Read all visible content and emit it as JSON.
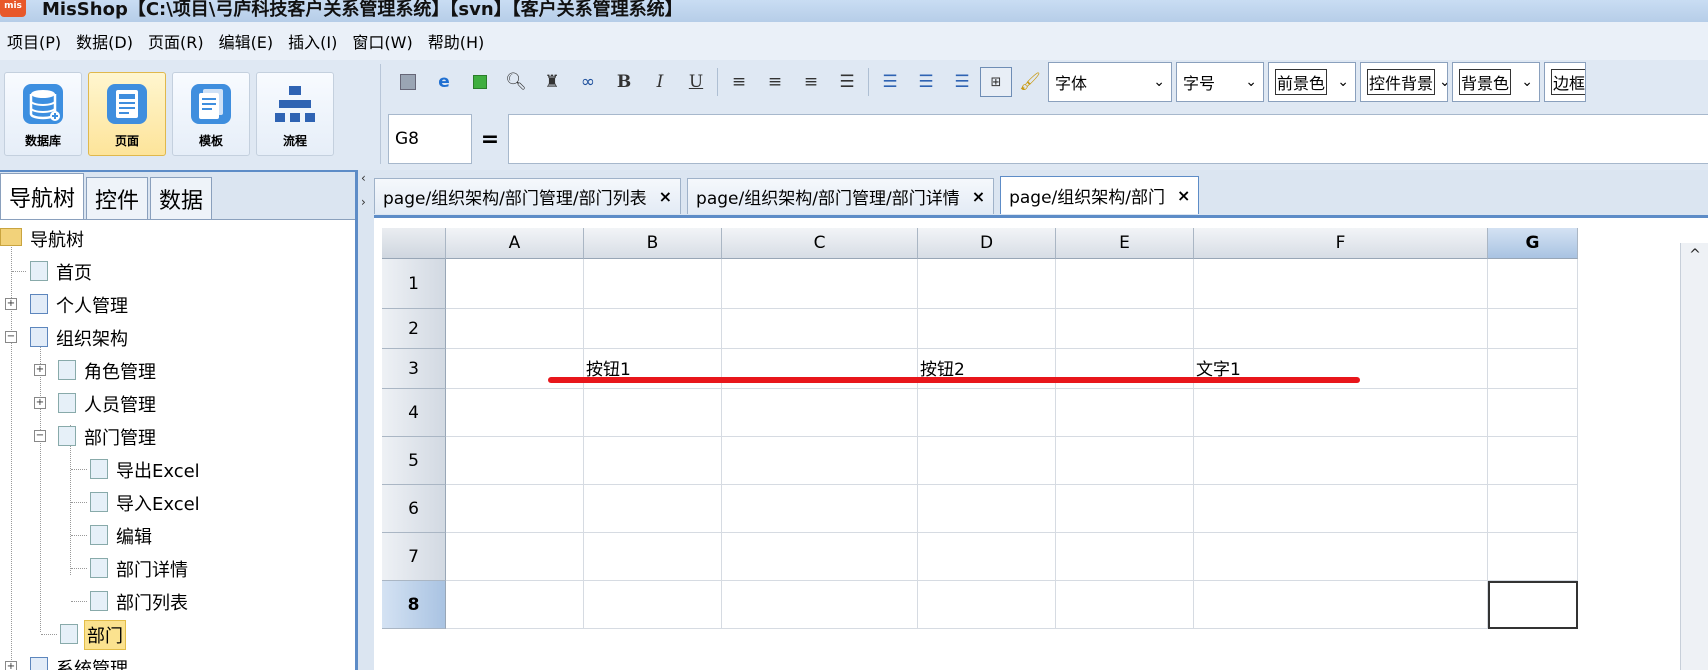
{
  "window": {
    "app_icon_text": "mis",
    "title": "MisShop【C:\\项目\\弓庐科技客户关系管理系统】【svn】【客户关系管理系统】"
  },
  "menu": [
    {
      "label": "项目(P)"
    },
    {
      "label": "数据(D)"
    },
    {
      "label": "页面(R)"
    },
    {
      "label": "编辑(E)"
    },
    {
      "label": "插入(I)"
    },
    {
      "label": "窗口(W)"
    },
    {
      "label": "帮助(H)"
    }
  ],
  "big_buttons": [
    {
      "label": "数据库",
      "icon": "database-icon",
      "color": "#3d8fe0"
    },
    {
      "label": "页面",
      "icon": "page-icon",
      "color": "#3f8ede"
    },
    {
      "label": "模板",
      "icon": "template-icon",
      "color": "#3f8ede"
    },
    {
      "label": "流程",
      "icon": "flowchart-icon",
      "color": "#2f63b3"
    }
  ],
  "toolbar": {
    "bold": "B",
    "italic": "I",
    "underline": "U",
    "font_select": "字体",
    "size_select": "字号",
    "fg_select": "前景色",
    "control_bg_select": "控件背景",
    "bg_select": "背景色",
    "border_select": "边框"
  },
  "formula": {
    "cell_ref": "G8",
    "equals": "=",
    "value": ""
  },
  "left_tabs": [
    {
      "label": "导航树"
    },
    {
      "label": "控件"
    },
    {
      "label": "数据"
    }
  ],
  "tree": [
    {
      "label": "导航树"
    },
    {
      "label": "首页"
    },
    {
      "label": "个人管理"
    },
    {
      "label": "组织架构"
    },
    {
      "label": "角色管理"
    },
    {
      "label": "人员管理"
    },
    {
      "label": "部门管理"
    },
    {
      "label": "导出Excel"
    },
    {
      "label": "导入Excel"
    },
    {
      "label": "编辑"
    },
    {
      "label": "部门详情"
    },
    {
      "label": "部门列表"
    },
    {
      "label": "部门"
    },
    {
      "label": "系统管理"
    }
  ],
  "doc_tabs": [
    {
      "label": "page/组织架构/部门管理/部门列表"
    },
    {
      "label": "page/组织架构/部门管理/部门详情"
    },
    {
      "label": "page/组织架构/部门"
    }
  ],
  "sheet": {
    "columns": [
      "A",
      "B",
      "C",
      "D",
      "E",
      "F",
      "G"
    ],
    "rows": [
      "1",
      "2",
      "3",
      "4",
      "5",
      "6",
      "7",
      "8"
    ],
    "selected_cell": "G8",
    "cells": [
      {
        "ref": "B3",
        "text": "按钮1"
      },
      {
        "ref": "D3",
        "text": "按钮2"
      },
      {
        "ref": "F3",
        "text": "文字1"
      }
    ],
    "annotation_color": "#e8161b"
  }
}
